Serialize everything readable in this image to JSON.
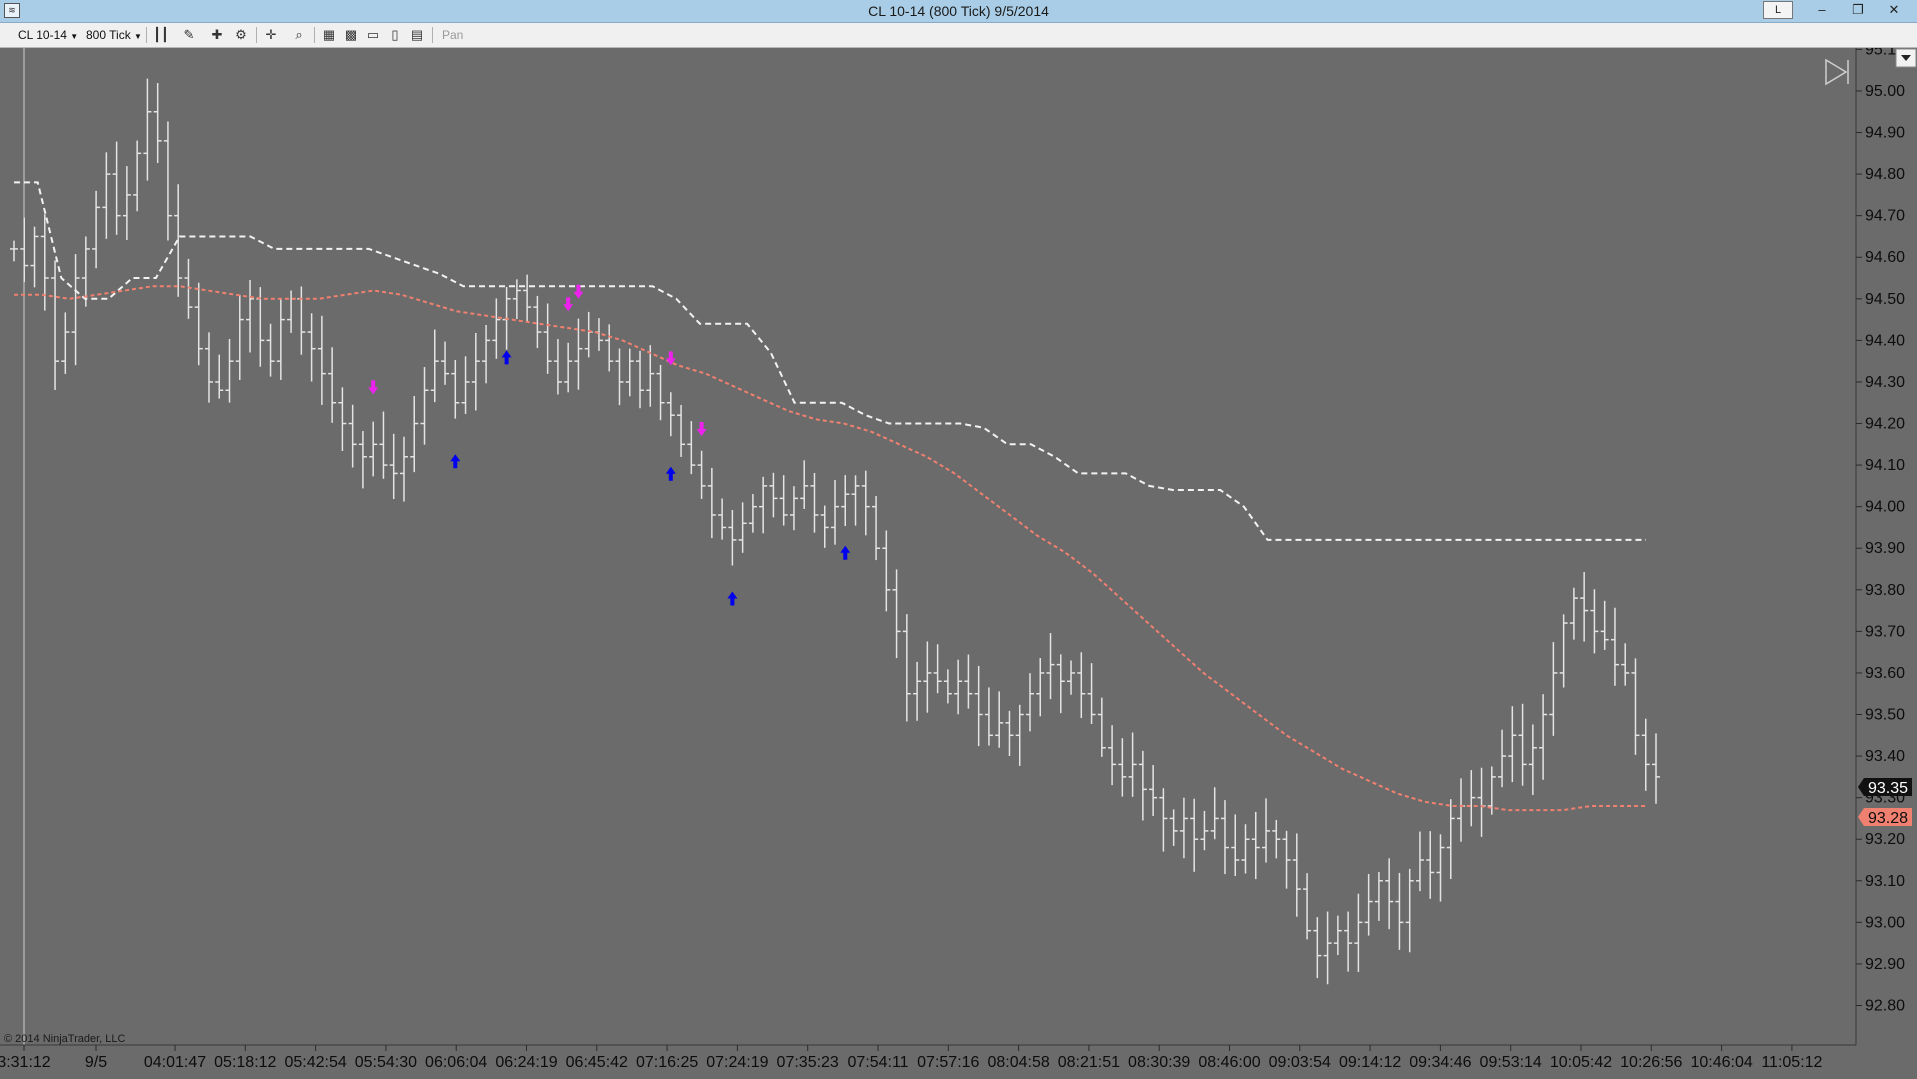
{
  "window": {
    "title": "CL 10-14 (800 Tick)  9/5/2014",
    "buttons": {
      "l_label": "L",
      "minimize": "–",
      "restore": "❐",
      "close": "✕"
    }
  },
  "toolbar": {
    "instrument": "CL 10-14",
    "interval": "800 Tick",
    "pan_label": "Pan",
    "icons": [
      "bar-type-icon",
      "drawing-pencil-icon",
      "add-indicator-icon",
      "strategy-icon",
      "crosshair-icon",
      "zoom-icon",
      "data-box-icon",
      "chart-properties-icon",
      "snapshot-icon",
      "print-icon",
      "template-icon"
    ]
  },
  "colors": {
    "background": "#6b6b6b",
    "bars": "#e4e4e4",
    "dashed_white": "#f2f2f2",
    "moving_average": "#f08070",
    "buy_arrow": "#0000ee",
    "sell_arrow": "#ee22ee"
  },
  "chart_data": {
    "type": "ohlc-bar",
    "title": "",
    "y_axis": {
      "tick_labels": [
        "95.1",
        "95.00",
        "94.90",
        "94.80",
        "94.70",
        "94.60",
        "94.50",
        "94.40",
        "94.30",
        "94.20",
        "94.10",
        "94.00",
        "93.90",
        "93.80",
        "93.70",
        "93.60",
        "93.50",
        "93.40",
        "93.30",
        "93.20",
        "93.10",
        "93.00",
        "92.90",
        "92.80"
      ],
      "range": [
        92.77,
        95.13
      ]
    },
    "x_axis": {
      "tick_labels": [
        "3:31:12",
        "9/5",
        "04:01:47",
        "05:18:12",
        "05:42:54",
        "05:54:30",
        "06:06:04",
        "06:24:19",
        "06:45:42",
        "07:16:25",
        "07:24:19",
        "07:35:23",
        "07:54:11",
        "07:57:16",
        "08:04:58",
        "08:21:51",
        "08:30:39",
        "08:46:00",
        "09:03:54",
        "09:14:12",
        "09:34:46",
        "09:53:14",
        "10:05:42",
        "10:26:56",
        "10:46:04",
        "11:05:12"
      ]
    },
    "last_price_label": "93.35",
    "ma_label": "93.28",
    "hidden_label": "93.30",
    "close_path": [
      94.62,
      94.58,
      94.65,
      94.55,
      94.35,
      94.42,
      94.55,
      94.62,
      94.72,
      94.8,
      94.7,
      94.75,
      94.85,
      94.95,
      94.88,
      94.7,
      94.55,
      94.48,
      94.38,
      94.3,
      94.28,
      94.35,
      94.45,
      94.5,
      94.4,
      94.35,
      94.45,
      94.5,
      94.42,
      94.38,
      94.32,
      94.25,
      94.2,
      94.15,
      94.12,
      94.15,
      94.1,
      94.08,
      94.12,
      94.2,
      94.28,
      94.35,
      94.32,
      94.25,
      94.3,
      94.35,
      94.4,
      94.45,
      94.5,
      94.52,
      94.48,
      94.42,
      94.35,
      94.3,
      94.35,
      94.38,
      94.42,
      94.4,
      94.35,
      94.3,
      94.35,
      94.28,
      94.32,
      94.25,
      94.22,
      94.15,
      94.1,
      94.05,
      93.98,
      93.95,
      93.92,
      93.96,
      94.0,
      94.05,
      94.02,
      93.98,
      94.02,
      94.05,
      93.98,
      93.95,
      94.0,
      94.03,
      94.05,
      94.0,
      93.9,
      93.8,
      93.7,
      93.55,
      93.58,
      93.6,
      93.58,
      93.55,
      93.58,
      93.55,
      93.5,
      93.45,
      93.48,
      93.45,
      93.5,
      93.55,
      93.6,
      93.62,
      93.58,
      93.6,
      93.55,
      93.5,
      93.42,
      93.38,
      93.35,
      93.38,
      93.32,
      93.3,
      93.25,
      93.22,
      93.25,
      93.2,
      93.22,
      93.25,
      93.18,
      93.15,
      93.2,
      93.18,
      93.22,
      93.2,
      93.15,
      93.08,
      92.98,
      92.92,
      92.95,
      92.98,
      92.95,
      93.0,
      93.05,
      93.1,
      93.05,
      93.0,
      93.1,
      93.15,
      93.12,
      93.18,
      93.25,
      93.28,
      93.3,
      93.28,
      93.35,
      93.4,
      93.45,
      93.38,
      93.42,
      93.5,
      93.6,
      93.72,
      93.78,
      93.75,
      93.7,
      93.68,
      93.62,
      93.6,
      93.45,
      93.38,
      93.35
    ],
    "series": [
      {
        "kind": "dashed-stop",
        "values": [
          94.78,
          94.78,
          94.55,
          94.5,
          94.5,
          94.55,
          94.55,
          94.65,
          94.65,
          94.65,
          94.65,
          94.62,
          94.62,
          94.62,
          94.62,
          94.62,
          94.6,
          94.58,
          94.56,
          94.53,
          94.53,
          94.53,
          94.53,
          94.53,
          94.53,
          94.53,
          94.53,
          94.53,
          94.5,
          94.44,
          94.44,
          94.44,
          94.37,
          94.25,
          94.25,
          94.25,
          94.22,
          94.2,
          94.2,
          94.2,
          94.2,
          94.19,
          94.15,
          94.15,
          94.12,
          94.08,
          94.08,
          94.08,
          94.05,
          94.04,
          94.04,
          94.04,
          94.0,
          93.92,
          93.92,
          93.92,
          93.92,
          93.92,
          93.92,
          93.92,
          93.92,
          93.92,
          93.92,
          93.92,
          93.92,
          93.92,
          93.92,
          93.92,
          93.92,
          93.92
        ]
      },
      {
        "kind": "moving-average",
        "values": [
          94.51,
          94.51,
          94.5,
          94.51,
          94.52,
          94.53,
          94.53,
          94.52,
          94.51,
          94.5,
          94.5,
          94.5,
          94.51,
          94.52,
          94.51,
          94.49,
          94.47,
          94.46,
          94.45,
          94.44,
          94.43,
          94.42,
          94.4,
          94.37,
          94.34,
          94.32,
          94.29,
          94.26,
          94.23,
          94.21,
          94.2,
          94.18,
          94.15,
          94.12,
          94.08,
          94.03,
          93.98,
          93.93,
          93.89,
          93.84,
          93.78,
          93.72,
          93.66,
          93.6,
          93.55,
          93.5,
          93.45,
          93.41,
          93.37,
          93.34,
          93.31,
          93.29,
          93.28,
          93.28,
          93.27,
          93.27,
          93.27,
          93.28,
          93.28,
          93.28
        ]
      }
    ],
    "signals": {
      "buy_arrows": [
        "bar 43",
        "bar 48",
        "bar 64",
        "bar 70",
        "bar 81"
      ],
      "sell_arrows": [
        "bar 35",
        "bar 54",
        "bar 55",
        "bar 64",
        "bar 67"
      ]
    },
    "copyright": "© 2014 NinjaTrader, LLC"
  }
}
